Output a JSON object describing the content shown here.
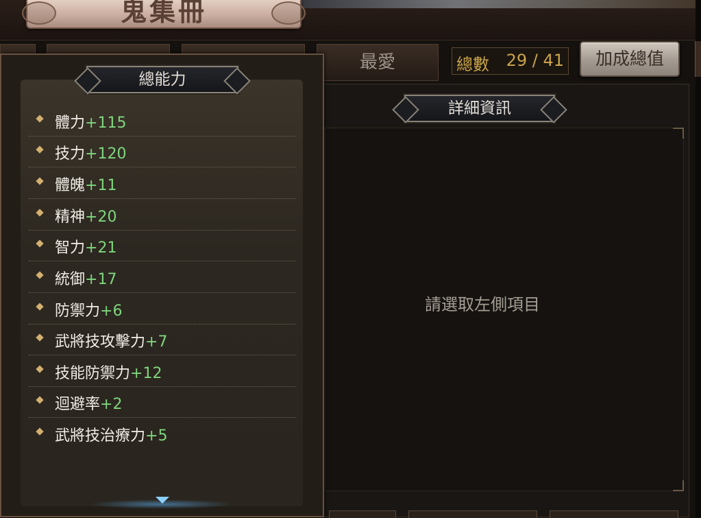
{
  "title": "鬼集冊",
  "tabs": [
    {
      "label": ""
    },
    {
      "label": ""
    },
    {
      "label": ""
    },
    {
      "label": "最愛"
    }
  ],
  "count": {
    "label": "總數",
    "value": "29 / 41"
  },
  "bonus_button": "加成總值",
  "detail": {
    "header": "詳細資訊",
    "empty_message": "請選取左側項目"
  },
  "stats": {
    "header": "總能力",
    "items": [
      {
        "name": "體力",
        "value": "+115"
      },
      {
        "name": "技力",
        "value": "+120"
      },
      {
        "name": "體魄",
        "value": "+11"
      },
      {
        "name": "精神",
        "value": "+20"
      },
      {
        "name": "智力",
        "value": "+21"
      },
      {
        "name": "統御",
        "value": "+17"
      },
      {
        "name": "防禦力",
        "value": "+6"
      },
      {
        "name": "武將技攻擊力",
        "value": "+7"
      },
      {
        "name": "技能防禦力",
        "value": "+12"
      },
      {
        "name": "迴避率",
        "value": "+2"
      },
      {
        "name": "武將技治療力",
        "value": "+5"
      }
    ]
  },
  "colors": {
    "stat_value": "#7fd67d",
    "count_text": "#c9a449",
    "panel_border": "#6a5240"
  }
}
